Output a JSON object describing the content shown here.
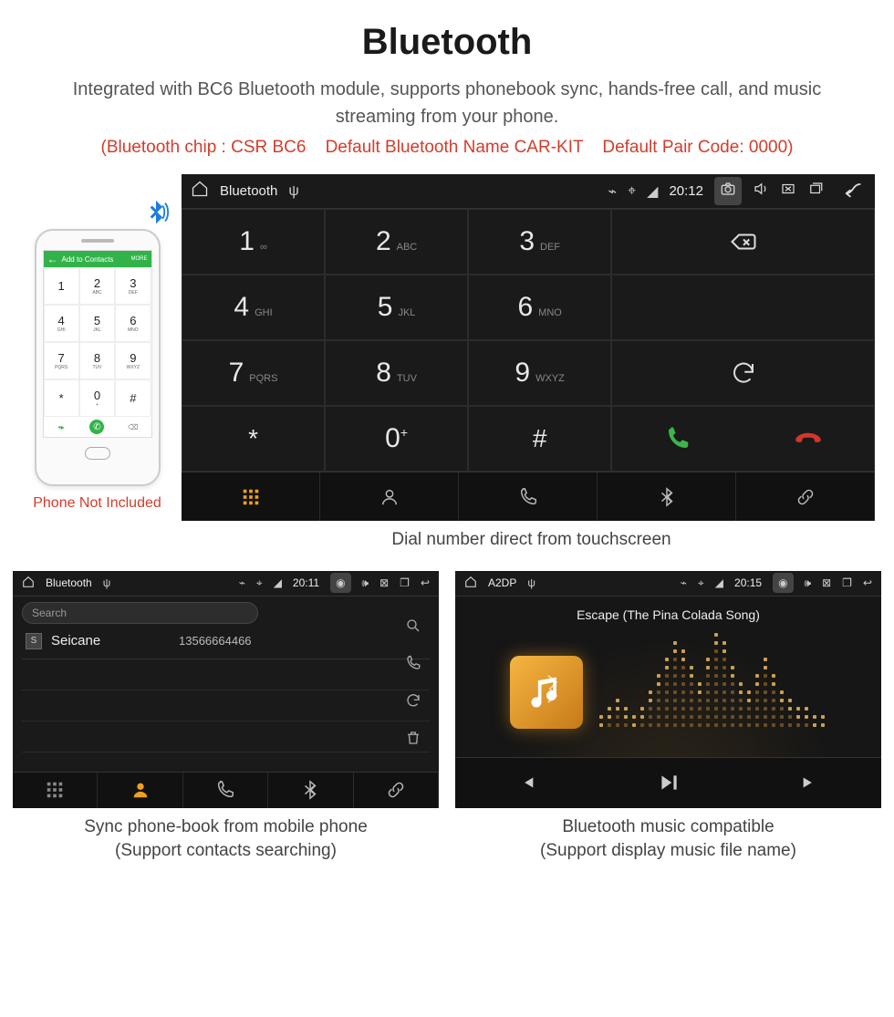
{
  "title": "Bluetooth",
  "subtitle": "Integrated with BC6 Bluetooth module, supports phonebook sync, hands-free call, and music streaming from your phone.",
  "spec": "(Bluetooth chip : CSR BC6    Default Bluetooth Name CAR-KIT    Default Pair Code: 0000)",
  "phoneNote": "Phone Not Included",
  "phoneHeader": {
    "label": "Add to Contacts",
    "more": "MORE"
  },
  "phoneKeys": [
    {
      "n": "1",
      "s": ""
    },
    {
      "n": "2",
      "s": "ABC"
    },
    {
      "n": "3",
      "s": "DEF"
    },
    {
      "n": "4",
      "s": "GHI"
    },
    {
      "n": "5",
      "s": "JKL"
    },
    {
      "n": "6",
      "s": "MNO"
    },
    {
      "n": "7",
      "s": "PQRS"
    },
    {
      "n": "8",
      "s": "TUV"
    },
    {
      "n": "9",
      "s": "WXYZ"
    },
    {
      "n": "*",
      "s": ""
    },
    {
      "n": "0",
      "s": "+"
    },
    {
      "n": "#",
      "s": ""
    }
  ],
  "dialer": {
    "barTitle": "Bluetooth",
    "time": "20:12",
    "keys": [
      {
        "n": "1",
        "s": "∞"
      },
      {
        "n": "2",
        "s": "ABC"
      },
      {
        "n": "3",
        "s": "DEF"
      },
      {
        "n": "4",
        "s": "GHI"
      },
      {
        "n": "5",
        "s": "JKL"
      },
      {
        "n": "6",
        "s": "MNO"
      },
      {
        "n": "7",
        "s": "PQRS"
      },
      {
        "n": "8",
        "s": "TUV"
      },
      {
        "n": "9",
        "s": "WXYZ"
      },
      {
        "n": "*",
        "s": ""
      },
      {
        "n": "0",
        "s": "+",
        "sup": true
      },
      {
        "n": "#",
        "s": ""
      }
    ],
    "caption": "Dial number direct from touchscreen"
  },
  "phonebook": {
    "barTitle": "Bluetooth",
    "time": "20:11",
    "search": "Search",
    "contact": {
      "initial": "S",
      "name": "Seicane",
      "number": "13566664466"
    },
    "caption1": "Sync phone-book from mobile phone",
    "caption2": "(Support contacts searching)"
  },
  "music": {
    "barTitle": "A2DP",
    "time": "20:15",
    "track": "Escape (The Pina Colada Song)",
    "caption1": "Bluetooth music compatible",
    "caption2": "(Support display music file name)"
  }
}
